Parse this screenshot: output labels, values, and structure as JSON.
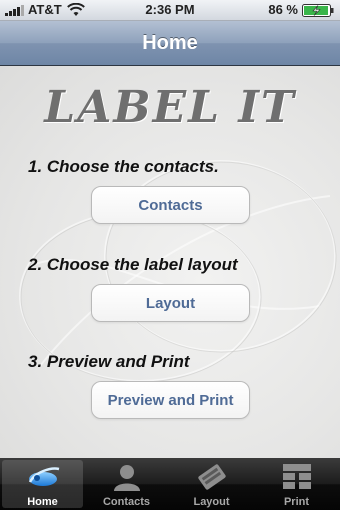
{
  "status_bar": {
    "carrier": "AT&T",
    "time": "2:36 PM",
    "battery": "86 %"
  },
  "nav": {
    "title": "Home"
  },
  "logo": {
    "text": "LABEL IT"
  },
  "steps": [
    {
      "label": "1. Choose the contacts.",
      "button": "Contacts"
    },
    {
      "label": "2. Choose the label layout",
      "button": "Layout"
    },
    {
      "label": "3. Preview and Print",
      "button": "Preview and Print"
    }
  ],
  "tabs": [
    {
      "label": "Home",
      "icon": "home-icon",
      "active": true
    },
    {
      "label": "Contacts",
      "icon": "contacts-icon",
      "active": false
    },
    {
      "label": "Layout",
      "icon": "layout-icon",
      "active": false
    },
    {
      "label": "Print",
      "icon": "print-icon",
      "active": false
    }
  ],
  "colors": {
    "nav_blue": "#7f93b0",
    "button_text": "#4f6b96",
    "tab_active_bg": "#3a3a3a"
  }
}
